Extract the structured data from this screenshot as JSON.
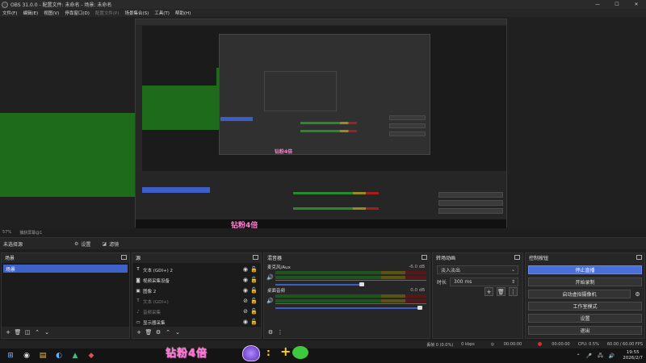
{
  "window": {
    "title": "OBS 31.0.0 - 配置文件: 未命名 - 场景: 未命名"
  },
  "menu": [
    {
      "label": "文件(F)",
      "enabled": true
    },
    {
      "label": "编辑(E)",
      "enabled": true
    },
    {
      "label": "视图(V)",
      "enabled": true
    },
    {
      "label": "停靠窗口(D)",
      "enabled": true
    },
    {
      "label": "配置文件(P)",
      "enabled": false
    },
    {
      "label": "场景集合(S)",
      "enabled": true
    },
    {
      "label": "工具(T)",
      "enabled": true
    },
    {
      "label": "帮助(H)",
      "enabled": true
    }
  ],
  "strip": {
    "zoom": "57%",
    "label": "捕获屏幕@1"
  },
  "source_bar": {
    "no_selection": "未选择源",
    "properties_label": "设置",
    "filters_label": "滤镜"
  },
  "scenes": {
    "title": "场景",
    "items": [
      "场景"
    ]
  },
  "sources": {
    "title": "源",
    "items": [
      {
        "label": "文本 (GDI+) 2",
        "icon": "text-icon",
        "visible": true,
        "dim": false
      },
      {
        "label": "视频采集设备",
        "icon": "camera-icon",
        "visible": true,
        "dim": false
      },
      {
        "label": "图像 2",
        "icon": "image-icon",
        "visible": true,
        "dim": false
      },
      {
        "label": "文本 (GDI+)",
        "icon": "text-icon",
        "visible": false,
        "dim": true
      },
      {
        "label": "音频采集",
        "icon": "audio-icon",
        "visible": false,
        "dim": true
      },
      {
        "label": "显示器采集",
        "icon": "monitor-icon",
        "visible": true,
        "dim": false
      }
    ]
  },
  "mixer": {
    "title": "混音器",
    "channels": [
      {
        "name": "麦克风/Aux",
        "db": "-6.0 dB",
        "level": 0.6
      },
      {
        "name": "桌面音频",
        "db": "0.0 dB",
        "level": 1.0
      }
    ]
  },
  "transitions": {
    "title": "转场动画",
    "selected": "淡入淡出",
    "duration_label": "时长",
    "duration": "300 ms"
  },
  "controls": {
    "title": "控制按钮",
    "buttons": [
      "停止直播",
      "开始录制",
      "启动虚拟摄像机",
      "工作室模式",
      "设置",
      "退出"
    ]
  },
  "status": {
    "frames": "丢帧 0 (0.0%)",
    "bitrate": "0 kbps",
    "stream_time": "00:00:00",
    "rec_time": "00:00:00",
    "cpu": "CPU: 0.5%",
    "fps": "60.00 / 60.00 FPS"
  },
  "overlay": {
    "text": "钻粉4倍",
    "colon": ":",
    "plus": "+"
  },
  "taskbar": {
    "time": "19:55",
    "date": "2026/2/7"
  },
  "colors": {
    "accent": "#4b6fd8",
    "preview_green": "#1f6b1c",
    "overlay_pink": "#ff6fd0"
  }
}
